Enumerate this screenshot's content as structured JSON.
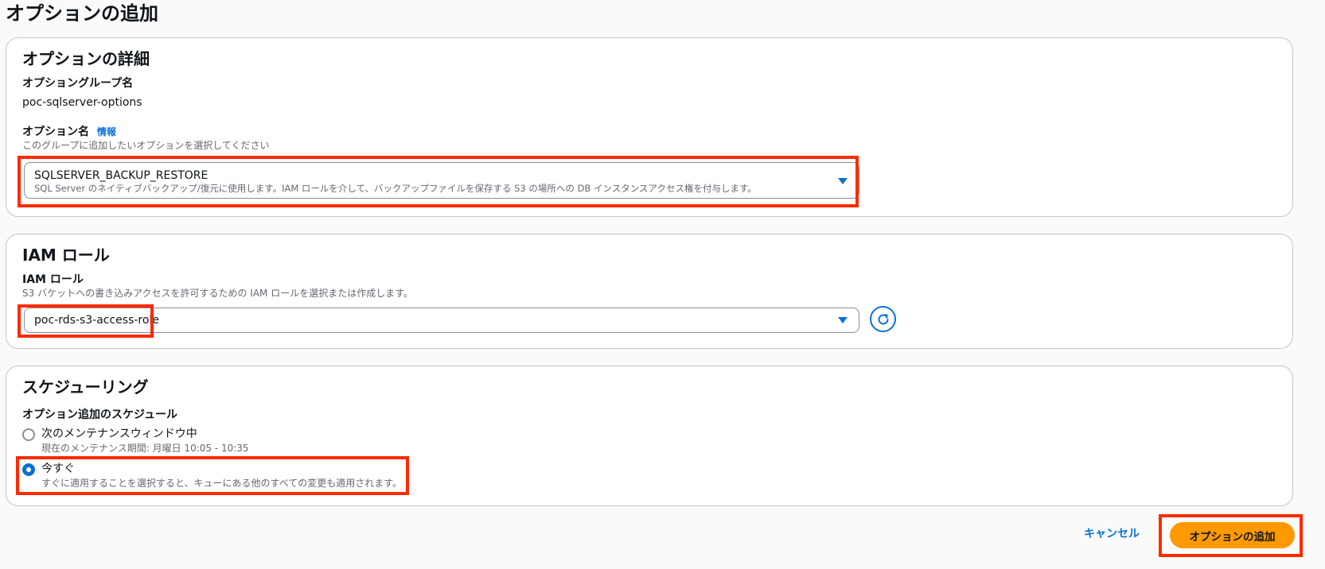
{
  "page": {
    "title": "オプションの追加"
  },
  "option_details": {
    "heading": "オプションの詳細",
    "group_name_label": "オプショングループ名",
    "group_name_value": "poc-sqlserver-options",
    "option_name_label": "オプション名",
    "info_link": "情報",
    "option_name_desc": "このグループに追加したいオプションを選択してください",
    "selected_option": "SQLSERVER_BACKUP_RESTORE",
    "selected_option_desc": "SQL Server のネイティブバックアップ/復元に使用します。IAM ロールを介して、バックアップファイルを保存する S3 の場所への DB インスタンスアクセス権を付与します。"
  },
  "iam_role": {
    "heading": "IAM ロール",
    "label": "IAM ロール",
    "desc": "S3 バケットへの書き込みアクセスを許可するための IAM ロールを選択または作成します。",
    "selected_role": "poc-rds-s3-access-role"
  },
  "scheduling": {
    "heading": "スケジューリング",
    "label": "オプション追加のスケジュール",
    "options": [
      {
        "label": "次のメンテナンスウィンドウ中",
        "desc": "現在のメンテナンス期間: 月曜日 10:05 - 10:35",
        "selected": false
      },
      {
        "label": "今すぐ",
        "desc": "すぐに適用することを選択すると、キューにある他のすべての変更も適用されます。",
        "selected": true
      }
    ]
  },
  "footer": {
    "cancel_label": "キャンセル",
    "submit_label": "オプションの追加"
  },
  "colors": {
    "accent": "#0972d3",
    "primary_button": "#ff9900",
    "highlight": "#ff2a00"
  },
  "icons": {
    "select_caret": "caret-down-icon",
    "refresh": "refresh-icon"
  }
}
